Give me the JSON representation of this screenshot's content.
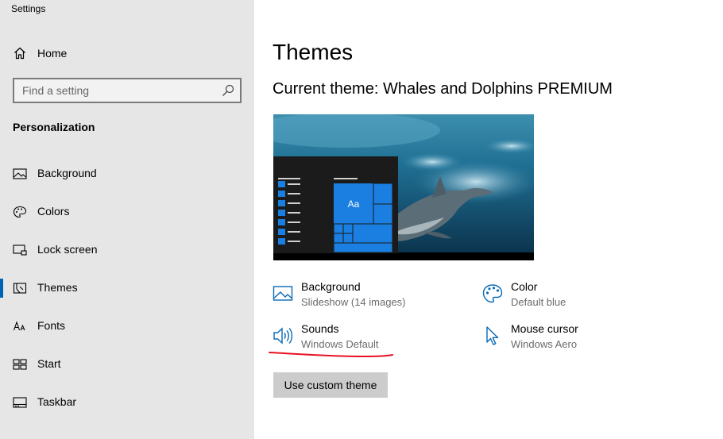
{
  "app": {
    "title": "Settings"
  },
  "sidebar": {
    "home_label": "Home",
    "search_placeholder": "Find a setting",
    "section_title": "Personalization",
    "items": [
      {
        "label": "Background",
        "icon": "picture-icon",
        "active": false
      },
      {
        "label": "Colors",
        "icon": "palette-icon",
        "active": false
      },
      {
        "label": "Lock screen",
        "icon": "lock-screen-icon",
        "active": false
      },
      {
        "label": "Themes",
        "icon": "themes-icon",
        "active": true
      },
      {
        "label": "Fonts",
        "icon": "fonts-icon",
        "active": false
      },
      {
        "label": "Start",
        "icon": "start-icon",
        "active": false
      },
      {
        "label": "Taskbar",
        "icon": "taskbar-icon",
        "active": false
      }
    ]
  },
  "main": {
    "title": "Themes",
    "current_theme": "Current theme: Whales and Dolphins PREMIUM",
    "preview": {
      "tile_label": "Aa"
    },
    "properties": [
      {
        "name": "Background",
        "value": "Slideshow (14 images)",
        "icon": "picture-icon"
      },
      {
        "name": "Color",
        "value": "Default blue",
        "icon": "palette-icon"
      },
      {
        "name": "Sounds",
        "value": "Windows Default",
        "icon": "speaker-icon"
      },
      {
        "name": "Mouse cursor",
        "value": "Windows Aero",
        "icon": "cursor-icon"
      }
    ],
    "custom_button_label": "Use custom theme"
  },
  "colors": {
    "accent": "#0078d7",
    "annotation": "#e81123",
    "sidebar_bg": "#e6e6e6"
  }
}
